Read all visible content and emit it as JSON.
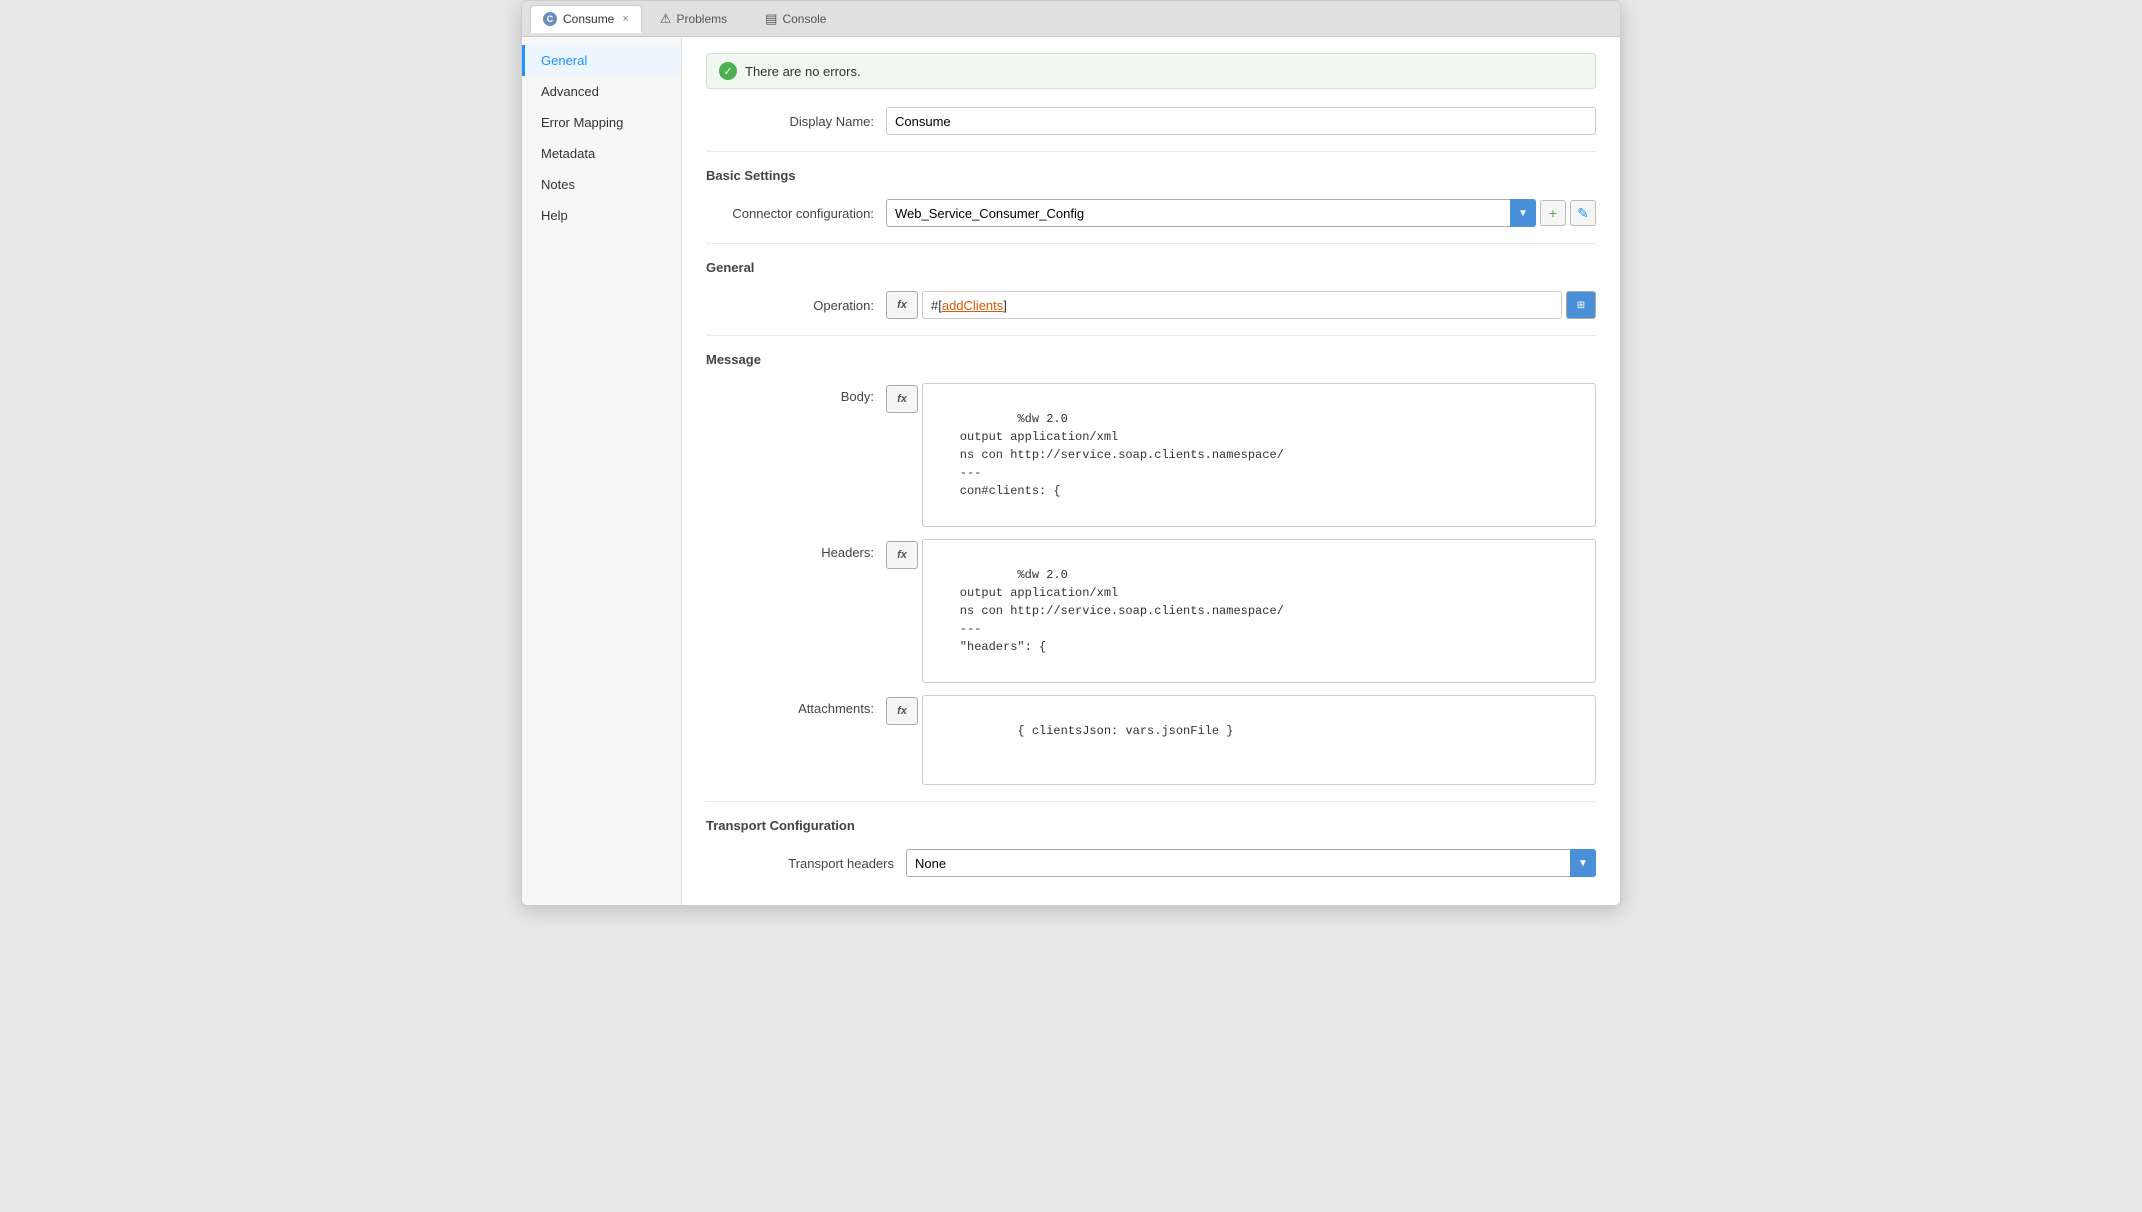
{
  "tabs": [
    {
      "id": "consume",
      "label": "Consume",
      "icon": "C",
      "active": true,
      "closable": true
    },
    {
      "id": "problems",
      "label": "Problems",
      "icon": "⚠",
      "active": false
    },
    {
      "id": "console",
      "label": "Console",
      "icon": "▤",
      "active": false
    }
  ],
  "sidebar": {
    "items": [
      {
        "id": "general",
        "label": "General",
        "active": true
      },
      {
        "id": "advanced",
        "label": "Advanced",
        "active": false
      },
      {
        "id": "error-mapping",
        "label": "Error Mapping",
        "active": false
      },
      {
        "id": "metadata",
        "label": "Metadata",
        "active": false
      },
      {
        "id": "notes",
        "label": "Notes",
        "active": false
      },
      {
        "id": "help",
        "label": "Help",
        "active": false
      }
    ]
  },
  "status": {
    "text": "There are no errors."
  },
  "form": {
    "display_name_label": "Display Name:",
    "display_name_value": "Consume",
    "basic_settings_title": "Basic Settings",
    "connector_config_label": "Connector configuration:",
    "connector_config_value": "Web_Service_Consumer_Config",
    "general_title": "General",
    "operation_label": "Operation:",
    "operation_value": "addClients",
    "message_title": "Message",
    "body_label": "Body:",
    "body_code": "%dw 2.0\n    output application/xml\n    ns con http://service.soap.clients.namespace/\n    ---\n    con#clients: {",
    "headers_label": "Headers:",
    "headers_code": "%dw 2.0\n    output application/xml\n    ns con http://service.soap.clients.namespace/\n    ---\n    \"headers\": {",
    "attachments_label": "Attachments:",
    "attachments_code": "{ clientsJson: vars.jsonFile }",
    "transport_title": "Transport Configuration",
    "transport_headers_label": "Transport headers",
    "transport_headers_value": "None"
  },
  "buttons": {
    "add_config": "+",
    "edit_config": "✎",
    "expression_map": "⊞",
    "fx_label": "fx"
  }
}
